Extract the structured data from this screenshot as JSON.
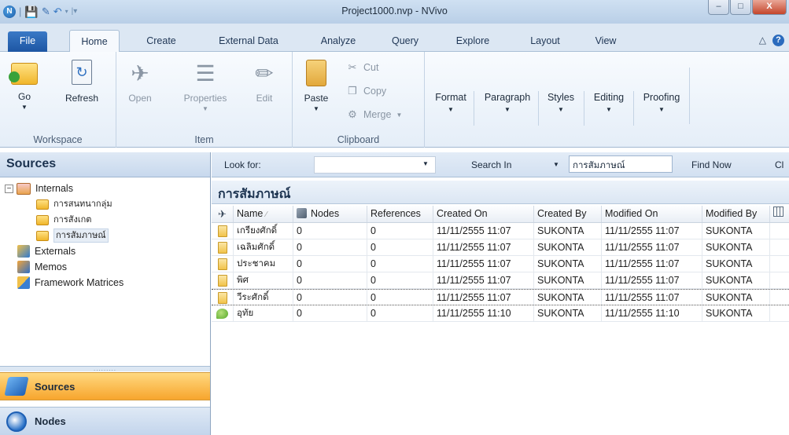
{
  "window": {
    "title": "Project1000.nvp - NVivo",
    "minimize": "–",
    "maximize": "□",
    "close": "X"
  },
  "ribbon_tabs": [
    "File",
    "Home",
    "Create",
    "External Data",
    "Analyze",
    "Query",
    "Explore",
    "Layout",
    "View"
  ],
  "ribbon": {
    "workspace": {
      "label": "Workspace",
      "go": "Go",
      "refresh": "Refresh"
    },
    "item": {
      "label": "Item",
      "open": "Open",
      "properties": "Properties",
      "edit": "Edit"
    },
    "clipboard": {
      "label": "Clipboard",
      "paste": "Paste",
      "cut": "Cut",
      "copy": "Copy",
      "merge": "Merge"
    },
    "format": "Format",
    "paragraph": "Paragraph",
    "styles": "Styles",
    "editing": "Editing",
    "proofing": "Proofing"
  },
  "navigation": {
    "title": "Sources",
    "tree": {
      "internals": "Internals",
      "children": [
        "การสนทนากลุ่ม",
        "การสังเกต",
        "การสัมภาษณ์"
      ],
      "externals": "Externals",
      "memos": "Memos",
      "framework_matrices": "Framework Matrices"
    },
    "buttons": {
      "sources": "Sources",
      "nodes": "Nodes"
    }
  },
  "find_bar": {
    "look_for_label": "Look for:",
    "look_for_value": "",
    "search_in_label": "Search In",
    "search_in_value": "การสัมภาษณ์",
    "find_now": "Find Now",
    "clear": "Cl"
  },
  "list": {
    "title": "การสัมภาษณ์",
    "columns": [
      "Name",
      "Nodes",
      "References",
      "Created On",
      "Created By",
      "Modified On",
      "Modified By"
    ],
    "rows": [
      {
        "type": "document",
        "name": "เกรียงศักดิ์",
        "nodes": "0",
        "references": "0",
        "created_on": "11/11/2555 11:07",
        "created_by": "SUKONTA",
        "modified_on": "11/11/2555 11:07",
        "modified_by": "SUKONTA"
      },
      {
        "type": "document",
        "name": "เฉลิมศักดิ์",
        "nodes": "0",
        "references": "0",
        "created_on": "11/11/2555 11:07",
        "created_by": "SUKONTA",
        "modified_on": "11/11/2555 11:07",
        "modified_by": "SUKONTA"
      },
      {
        "type": "document",
        "name": "ประชาคม",
        "nodes": "0",
        "references": "0",
        "created_on": "11/11/2555 11:07",
        "created_by": "SUKONTA",
        "modified_on": "11/11/2555 11:07",
        "modified_by": "SUKONTA"
      },
      {
        "type": "document",
        "name": "พิศ",
        "nodes": "0",
        "references": "0",
        "created_on": "11/11/2555 11:07",
        "created_by": "SUKONTA",
        "modified_on": "11/11/2555 11:07",
        "modified_by": "SUKONTA"
      },
      {
        "type": "document",
        "name": "วีระศักดิ์",
        "nodes": "0",
        "references": "0",
        "created_on": "11/11/2555 11:07",
        "created_by": "SUKONTA",
        "modified_on": "11/11/2555 11:07",
        "modified_by": "SUKONTA"
      },
      {
        "type": "memo",
        "name": "อุทัย",
        "nodes": "0",
        "references": "0",
        "created_on": "11/11/2555 11:10",
        "created_by": "SUKONTA",
        "modified_on": "11/11/2555 11:10",
        "modified_by": "SUKONTA"
      }
    ]
  },
  "colors": {
    "file_tab": "#1d56a3",
    "nav_selected": "#f7a52d",
    "title_bar": "#c4d7ec"
  }
}
